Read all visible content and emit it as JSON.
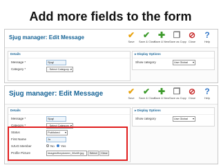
{
  "slide": {
    "title": "Add more fields to the form"
  },
  "toolbar": {
    "title": "Sjug manager: Edit Message",
    "buttons": [
      {
        "label": "Save",
        "icon": "save-icon"
      },
      {
        "label": "Save & Close",
        "icon": "check-icon"
      },
      {
        "label": "Save & New",
        "icon": "plus-icon"
      },
      {
        "label": "Save as Copy",
        "icon": "copy-icon"
      },
      {
        "label": "Close",
        "icon": "cancel-icon"
      },
      {
        "label": "Help",
        "icon": "help-icon"
      }
    ]
  },
  "details": {
    "heading": "Details",
    "message_label": "Message *",
    "message_value": "Sjug!",
    "category_label": "Category *",
    "category_value": "- Select Category -"
  },
  "display_options": {
    "heading": "Display Options",
    "show_category_label": "Show category",
    "show_category_value": "Use Global"
  },
  "new_fields": {
    "status_label": "Status",
    "status_value": "Published",
    "first_name_label": "First Name",
    "first_name_value": "Jo",
    "member_label": "SJUG Member",
    "member_no": "No",
    "member_yes": "Yes",
    "picture_label": "Profile Picture",
    "picture_value": "images/thepioneer_06c69.jpg",
    "select_button": "Select",
    "clear_button": "Clear"
  },
  "colors": {
    "highlight": "#e01c1c",
    "heading": "#146295"
  }
}
